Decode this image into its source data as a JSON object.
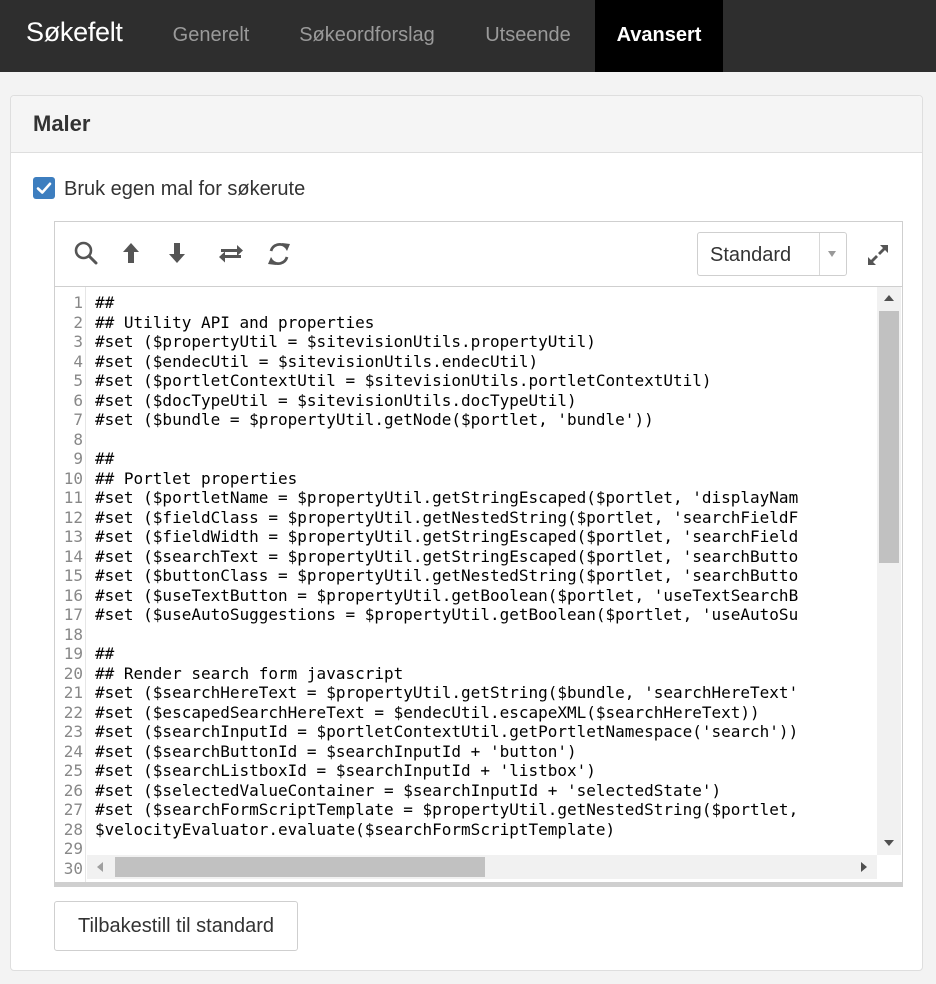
{
  "navbar": {
    "brand": "Søkefelt",
    "tabs": [
      {
        "label": "Generelt",
        "active": false
      },
      {
        "label": "Søkeordforslag",
        "active": false
      },
      {
        "label": "Utseende",
        "active": false
      },
      {
        "label": "Avansert",
        "active": true
      }
    ]
  },
  "panel": {
    "title": "Maler",
    "checkbox_label": "Bruk egen mal for søkerute",
    "checkbox_checked": true,
    "reset_button": "Tilbakestill til standard"
  },
  "editor": {
    "toolbar_icons": [
      "search-icon",
      "arrow-up-icon",
      "arrow-down-icon",
      "swap-icon",
      "refresh-icon"
    ],
    "theme_select": "Standard",
    "expand_icon": "expand-icon",
    "line_numbers": [
      "1",
      "2",
      "3",
      "4",
      "5",
      "6",
      "7",
      "8",
      "9",
      "10",
      "11",
      "12",
      "13",
      "14",
      "15",
      "16",
      "17",
      "18",
      "19",
      "20",
      "21",
      "22",
      "23",
      "24",
      "25",
      "26",
      "27",
      "28",
      "29",
      "30"
    ],
    "lines": [
      "##",
      "## Utility API and properties",
      "#set ($propertyUtil = $sitevisionUtils.propertyUtil)",
      "#set ($endecUtil = $sitevisionUtils.endecUtil)",
      "#set ($portletContextUtil = $sitevisionUtils.portletContextUtil)",
      "#set ($docTypeUtil = $sitevisionUtils.docTypeUtil)",
      "#set ($bundle = $propertyUtil.getNode($portlet, 'bundle'))",
      "",
      "##",
      "## Portlet properties",
      "#set ($portletName = $propertyUtil.getStringEscaped($portlet, 'displayNam",
      "#set ($fieldClass = $propertyUtil.getNestedString($portlet, 'searchFieldF",
      "#set ($fieldWidth = $propertyUtil.getStringEscaped($portlet, 'searchField",
      "#set ($searchText = $propertyUtil.getStringEscaped($portlet, 'searchButto",
      "#set ($buttonClass = $propertyUtil.getNestedString($portlet, 'searchButto",
      "#set ($useTextButton = $propertyUtil.getBoolean($portlet, 'useTextSearchB",
      "#set ($useAutoSuggestions = $propertyUtil.getBoolean($portlet, 'useAutoSu",
      "",
      "##",
      "## Render search form javascript",
      "#set ($searchHereText = $propertyUtil.getString($bundle, 'searchHereText'",
      "#set ($escapedSearchHereText = $endecUtil.escapeXML($searchHereText))",
      "#set ($searchInputId = $portletContextUtil.getPortletNamespace('search'))",
      "#set ($searchButtonId = $searchInputId + 'button')",
      "#set ($searchListboxId = $searchInputId + 'listbox')",
      "#set ($selectedValueContainer = $searchInputId + 'selectedState')",
      "#set ($searchFormScriptTemplate = $propertyUtil.getNestedString($portlet,",
      "$velocityEvaluator.evaluate($searchFormScriptTemplate)",
      "",
      ""
    ]
  },
  "colors": {
    "navbar_bg": "#2e2e2e",
    "active_tab_bg": "#000000",
    "checkbox_accent": "#3d7ebf"
  }
}
